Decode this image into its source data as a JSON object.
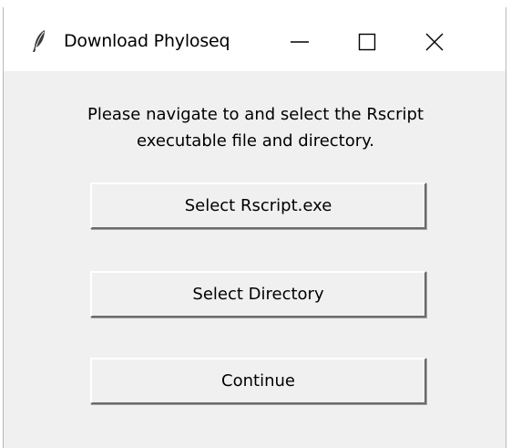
{
  "window": {
    "title": "Download Phyloseq",
    "icon": "feather-icon",
    "controls": [
      "minimize-icon",
      "maximize-icon",
      "close-icon"
    ]
  },
  "content": {
    "message_line1": "Please navigate to and select the Rscript",
    "message_line2": "executable file and directory."
  },
  "buttons": {
    "select_rscript": "Select Rscript.exe",
    "select_directory": "Select Directory",
    "continue": "Continue"
  },
  "colors": {
    "window_bg": "#f0f0f0",
    "titlebar_bg": "#ffffff"
  }
}
